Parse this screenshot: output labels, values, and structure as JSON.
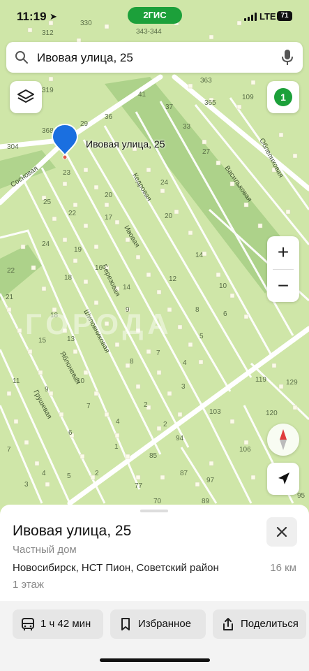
{
  "status": {
    "time": "11:19",
    "network": "LTE",
    "battery": "71"
  },
  "brand": "2ГИС",
  "search": {
    "value": "Ивовая улица, 25"
  },
  "filter_badge": "1",
  "map": {
    "pin_label": "Ивовая улица, 25",
    "watermark": "ГОРОДА",
    "streets": [
      "Сосновая",
      "Кедровая",
      "Ивовая",
      "Березовая",
      "Шиповниковая",
      "Яблоневая",
      "Грушевая",
      "Васильковая",
      "Облепиховая"
    ],
    "house_numbers": [
      "312",
      "330",
      "343-344",
      "319",
      "41",
      "363",
      "109",
      "368",
      "29",
      "36",
      "37",
      "365",
      "304",
      "33",
      "23",
      "25",
      "27",
      "24",
      "22",
      "17",
      "20",
      "24",
      "19",
      "21",
      "18",
      "16",
      "14",
      "15",
      "13",
      "11",
      "9",
      "8",
      "7",
      "6",
      "5",
      "4",
      "3",
      "2",
      "1",
      "12",
      "10",
      "119",
      "129",
      "120",
      "103",
      "106",
      "94",
      "85",
      "87",
      "97",
      "77",
      "70",
      "89",
      "95"
    ]
  },
  "card": {
    "title": "Ивовая улица, 25",
    "type": "Частный дом",
    "address": "Новосибирск, НСТ Пион, Советский район",
    "distance": "16 км",
    "floors": "1 этаж"
  },
  "actions": {
    "route": "1 ч 42 мин",
    "favorite": "Избранное",
    "share": "Поделиться"
  },
  "icons": [
    "search-icon",
    "mic-icon",
    "layers-icon",
    "close-icon",
    "bus-icon",
    "bookmark-icon",
    "share-icon",
    "compass-icon",
    "locate-icon",
    "location-arrow-icon"
  ],
  "colors": {
    "brand": "#1ca03a",
    "pin": "#1a6fe0",
    "map_bg": "#cfe6a8"
  }
}
